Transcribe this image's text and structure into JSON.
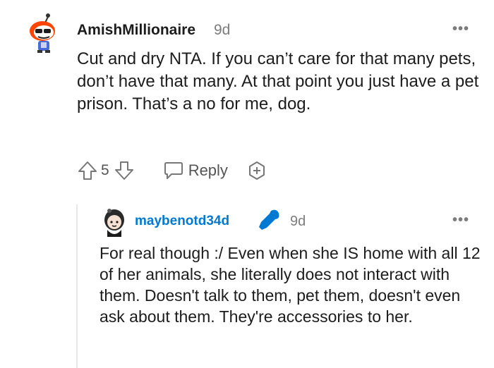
{
  "comment": {
    "username": "AmishMillionaire",
    "time": "9d",
    "body": "Cut and dry NTA. If you can’t care for that many pets, don’t have that many. At that point you just have a pet prison. That’s a no for me, dog.",
    "votes": "5",
    "reply_label": "Reply",
    "more_label": "•••"
  },
  "reply": {
    "username": "maybenotd34d",
    "time": "9d",
    "body": "For real though :/ Even when she IS home with all 12 of her animals, she literally does not interact with them. Doesn't talk to them, pet them, doesn't even ask about them. They're accessories to her.",
    "more_label": "•••"
  },
  "colors": {
    "username_link": "#0079d3",
    "meta_gray": "#7c7c7c",
    "avatar_orange": "#ff4500"
  },
  "icons": [
    "snoo-avatar",
    "upvote-icon",
    "downvote-icon",
    "reply-bubble-icon",
    "award-icon",
    "more-icon",
    "microphone-icon"
  ]
}
